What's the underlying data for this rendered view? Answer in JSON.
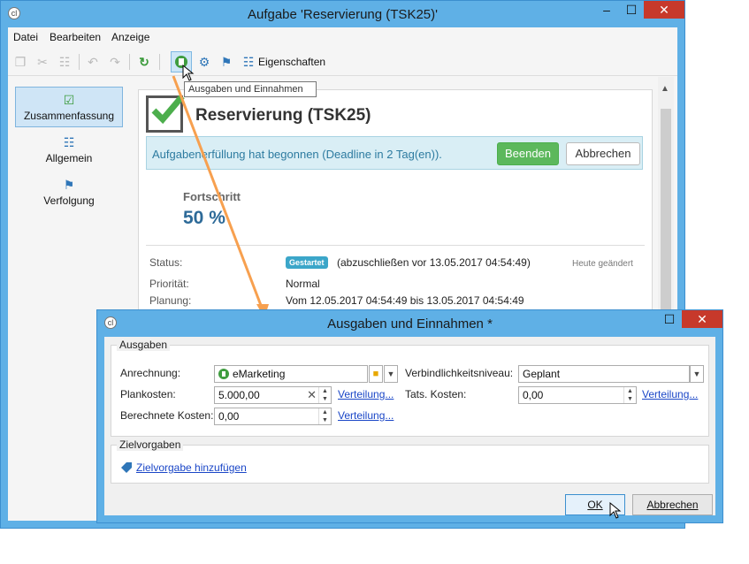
{
  "main_window": {
    "title": "Aufgabe 'Reservierung (TSK25)'",
    "app_icon": "cl",
    "menu": [
      "Datei",
      "Bearbeiten",
      "Anzeige"
    ],
    "toolbar": {
      "properties_label": "Eigenschaften",
      "tooltip": "Ausgaben und Einnahmen"
    },
    "nav": [
      {
        "label": "Zusammenfassung",
        "icon": "check-icon"
      },
      {
        "label": "Allgemein",
        "icon": "clipboard-icon"
      },
      {
        "label": "Verfolgung",
        "icon": "tracking-icon"
      }
    ],
    "summary": {
      "title": "Reservierung (TSK25)",
      "banner_text": "Aufgabenerfüllung hat begonnen (Deadline in 2 Tag(en)).",
      "finish_button": "Beenden",
      "cancel_button": "Abbrechen",
      "progress_label": "Fortschritt",
      "progress_value": "50 %",
      "status_label": "Status:",
      "status_badge": "Gestartet",
      "status_text": "(abzuschließen vor 13.05.2017 04:54:49)",
      "status_note": "Heute geändert",
      "priority_label": "Priorität:",
      "priority_value": "Normal",
      "planning_label": "Planung:",
      "planning_value": "Vom 12.05.2017 04:54:49 bis 13.05.2017 04:54:49"
    }
  },
  "dialog": {
    "title": "Ausgaben und Einnahmen *",
    "app_icon": "cl",
    "expenses": {
      "group_title": "Ausgaben",
      "charge_label": "Anrechnung:",
      "charge_value": "eMarketing",
      "commitment_label": "Verbindlichkeitsniveau:",
      "commitment_value": "Geplant",
      "planned_label": "Plankosten:",
      "planned_value": "5.000,00",
      "actual_label": "Tats. Kosten:",
      "actual_value": "0,00",
      "calculated_label": "Berechnete Kosten:",
      "calculated_value": "0,00",
      "distribution_link": "Verteilung..."
    },
    "targets": {
      "group_title": "Zielvorgaben",
      "add_link": "Zielvorgabe hinzufügen"
    },
    "ok_button": "OK",
    "cancel_button": "Abbrechen"
  },
  "colors": {
    "window_frame": "#5fb0e6",
    "close_button": "#c7392b",
    "accent_green": "#5cb85c",
    "link_blue": "#1a46c7",
    "arrow": "#f7a04f"
  }
}
